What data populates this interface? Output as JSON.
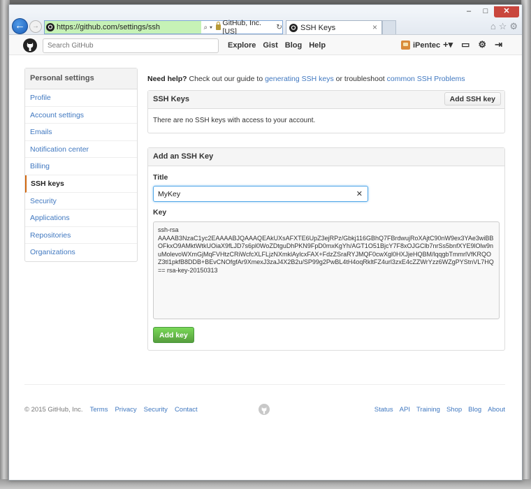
{
  "browser": {
    "url": "https://github.com/settings/ssh",
    "tools_label": "⌕ ▾",
    "cert_label": "GitHub, Inc. [US]",
    "refresh_icon": "↻",
    "tab_title": "SSH Keys",
    "tab_close": "×",
    "window_controls": {
      "minimize": "–",
      "maximize": "□",
      "close": "✕"
    },
    "icons": {
      "home": "⌂",
      "favorites": "☆",
      "settings": "⚙"
    }
  },
  "header": {
    "search_placeholder": "Search GitHub",
    "nav": [
      "Explore",
      "Gist",
      "Blog",
      "Help"
    ],
    "username": "iPentec",
    "actions": {
      "create": "+▾",
      "inbox": "▭",
      "settings": "⚙",
      "signout": "⇥"
    }
  },
  "sidebar": {
    "heading": "Personal settings",
    "items": [
      {
        "label": "Profile"
      },
      {
        "label": "Account settings"
      },
      {
        "label": "Emails"
      },
      {
        "label": "Notification center"
      },
      {
        "label": "Billing"
      },
      {
        "label": "SSH keys"
      },
      {
        "label": "Security"
      },
      {
        "label": "Applications"
      },
      {
        "label": "Repositories"
      },
      {
        "label": "Organizations"
      }
    ]
  },
  "help": {
    "prefix": "Need help?",
    "text1": " Check out our guide to ",
    "link1": "generating SSH keys",
    "text2": " or troubleshoot ",
    "link2": "common SSH Problems"
  },
  "ssh_keys_box": {
    "title": "SSH Keys",
    "add_button": "Add SSH key",
    "empty_message": "There are no SSH keys with access to your account."
  },
  "add_key_box": {
    "title": "Add an SSH Key",
    "title_label": "Title",
    "title_value": "MyKey",
    "clear_icon": "✕",
    "key_label": "Key",
    "key_value": "ssh-rsa\nAAAAB3NzaC1yc2EAAAABJQAAAQEAkUXsAFXTE6UpZ3ejRPz/Gbkj116GBhQ7FBrdwujRoXAjtC90nW9ex3YAe3wiBBOFkxO9AMktWtkUOiaX9fLJD7s6pl0WoZDtguDhPKN9FpD0mxKgYh/AGT1O51BjcY7F8xOJGClb7nrSs5bnfXYE9lOlw9nuMolevoWXmGjMqFVHtzCRiWcfcXLFLjzNXmklAylcxFAX+FdzZSraRYJMQF0cwXgl0HXJjeHQBM/lqqgbTmmrlVfKRQOZ3tl1pkfB8DDB+BEvCNOfgfAr9XmexJ3zaJ4X2B2u/SP99g2PwBL4tH4oqRkltFZ4url3zxE4cZZWrYzz6WZgPYStnVL7HQ== rsa-key-20150313",
    "submit_button": "Add key"
  },
  "footer": {
    "copyright": "© 2015 GitHub, Inc.",
    "left_links": [
      "Terms",
      "Privacy",
      "Security",
      "Contact"
    ],
    "right_links": [
      "Status",
      "API",
      "Training",
      "Shop",
      "Blog",
      "About"
    ]
  },
  "colors": {
    "link": "#4078c0",
    "green_button": "#569e3d",
    "selected_border": "#d26911",
    "url_bg": "#c6f2b6"
  }
}
